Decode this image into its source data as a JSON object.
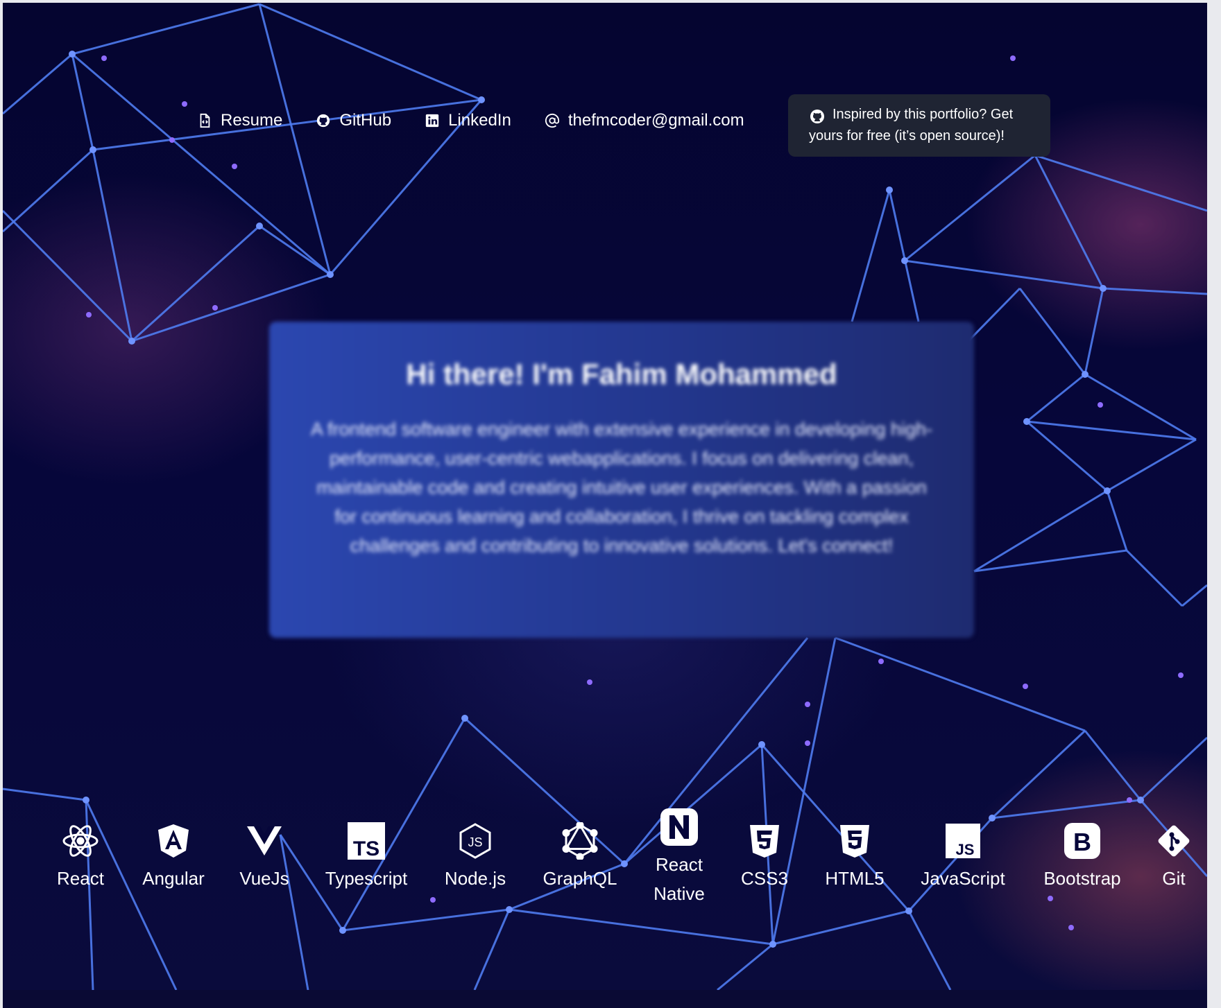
{
  "nav": {
    "resume": {
      "label": "Resume",
      "icon": "file-code-icon"
    },
    "github": {
      "label": "GitHub",
      "icon": "github-icon"
    },
    "linkedin": {
      "label": "LinkedIn",
      "icon": "linkedin-icon"
    },
    "email": {
      "label": "thefmcoder@gmail.com",
      "icon": "at-icon"
    }
  },
  "promo": {
    "text": "Inspired by this portfolio? Get yours for free (it’s open source)!",
    "icon": "github-icon"
  },
  "intro": {
    "title": "Hi there! I'm Fahim Mohammed",
    "body": "A frontend software engineer with extensive experience in developing high-performance, user-centric webapplications. I focus on delivering clean, maintainable code and creating intuitive user experiences. With a passion for continuous learning and collaboration, I thrive on tackling complex challenges and contributing to innovative solutions. Let's connect!"
  },
  "skills": [
    {
      "label": "React",
      "icon": "react-icon"
    },
    {
      "label": "Angular",
      "icon": "angular-icon"
    },
    {
      "label": "VueJs",
      "icon": "vue-icon"
    },
    {
      "label": "Typescript",
      "icon": "typescript-icon"
    },
    {
      "label": "Node.js",
      "icon": "nodejs-icon"
    },
    {
      "label": "GraphQL",
      "icon": "graphql-icon"
    },
    {
      "label": "React Native",
      "icon": "react-native-icon"
    },
    {
      "label": "CSS3",
      "icon": "css3-icon"
    },
    {
      "label": "HTML5",
      "icon": "html5-icon"
    },
    {
      "label": "JavaScript",
      "icon": "javascript-icon"
    },
    {
      "label": "Bootstrap",
      "icon": "bootstrap-icon"
    },
    {
      "label": "Git",
      "icon": "git-icon"
    }
  ],
  "colors": {
    "background": "#06063a",
    "network": "#4f7cf0",
    "card": "#2b47b0",
    "promo_bg": "#1f2433",
    "text": "#ffffff"
  }
}
